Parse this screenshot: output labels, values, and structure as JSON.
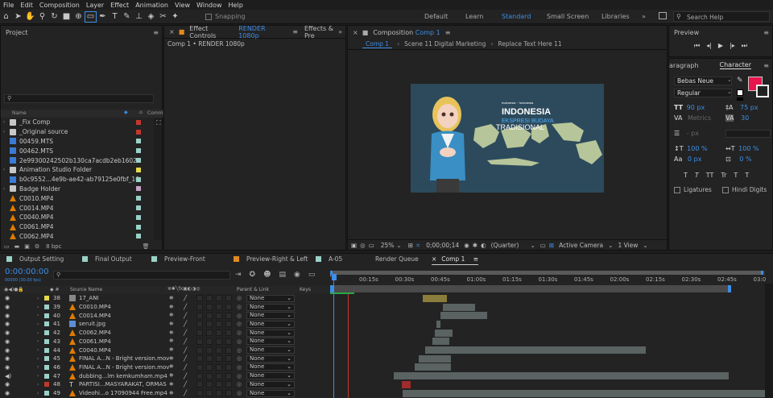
{
  "menu": [
    "File",
    "Edit",
    "Composition",
    "Layer",
    "Effect",
    "Animation",
    "View",
    "Window",
    "Help"
  ],
  "toolbar": {
    "snapping_label": "Snapping",
    "workspaces": [
      "Default",
      "Learn",
      "Standard",
      "Small Screen",
      "Libraries"
    ],
    "active_workspace": "Standard",
    "search_placeholder": "Search Help"
  },
  "project_panel": {
    "title": "Project",
    "col_name": "Name",
    "col_comment": "Comm",
    "bpc": "8 bpc",
    "items": [
      {
        "name": "_Fix Comp",
        "type": "folder",
        "label_color": "#c0392b"
      },
      {
        "name": "_Original source",
        "type": "folder",
        "label_color": "#c0392b"
      },
      {
        "name": "00459.MTS",
        "type": "file",
        "label_color": "#9ad1c8"
      },
      {
        "name": "00462.MTS",
        "type": "file",
        "label_color": "#9ad1c8"
      },
      {
        "name": "2e99300242502b130ca7acdb2eb16022.jpg",
        "type": "file",
        "label_color": "#9ad1c8"
      },
      {
        "name": "Animation Studio Folder",
        "type": "folder",
        "label_color": "#e6d84a"
      },
      {
        "name": "b0c9552...4e9b-ae42-ab79125e0fbf_169.jpeg",
        "type": "file",
        "label_color": "#9ad1c8"
      },
      {
        "name": "Badge Holder",
        "type": "folder",
        "label_color": "#c8a2c8"
      },
      {
        "name": "C0010.MP4",
        "type": "video",
        "label_color": "#9ad1c8"
      },
      {
        "name": "C0014.MP4",
        "type": "video",
        "label_color": "#9ad1c8"
      },
      {
        "name": "C0040.MP4",
        "type": "video",
        "label_color": "#9ad1c8"
      },
      {
        "name": "C0061.MP4",
        "type": "video",
        "label_color": "#9ad1c8"
      },
      {
        "name": "C0062.MP4",
        "type": "video",
        "label_color": "#9ad1c8"
      }
    ]
  },
  "effect_controls": {
    "tab_prefix": "Effect Controls",
    "tab_target": "RENDER 1080p",
    "tab2": "Effects & Pre",
    "breadcrumb": "Comp 1 • RENDER 1080p"
  },
  "composition_panel": {
    "tab_prefix": "Composition",
    "tab_target": "Comp 1",
    "nav": [
      "Comp 1",
      "Scene 11 Digital Marketing",
      "Replace Text Here 11"
    ],
    "zoom": "25%",
    "timecode": "0;00;00;14",
    "resolution": "(Quarter)",
    "camera": "Active Camera",
    "views": "1 View",
    "preview_text_small": "Indonesia ~ Indonesia",
    "preview_title": "INDONESIA",
    "preview_sub1": "EKSPRESI BUDAYA",
    "preview_sub2": "TRADISIONAL"
  },
  "preview_panel": {
    "title": "Preview"
  },
  "character_panel": {
    "tab1": "aragraph",
    "tab2": "Character",
    "font": "Bebas Neue",
    "style": "Regular",
    "font_size": "90 px",
    "leading": "75 px",
    "kerning": "Metrics",
    "tracking": "30",
    "indent": "- px",
    "vscale": "100 %",
    "hscale": "100 %",
    "baseline": "0 px",
    "tsume": "0 %",
    "ligatures": "Ligatures",
    "hindi_digits": "Hindi Digits",
    "fill_color": "#e8144c",
    "format_buttons": [
      "T",
      "T",
      "TT",
      "Tr",
      "T",
      "T"
    ]
  },
  "timeline": {
    "tabs": [
      {
        "name": "Output Setting",
        "color": "#9ad1c8"
      },
      {
        "name": "Final Output",
        "color": "#9ad1c8"
      },
      {
        "name": "Preview-Front",
        "color": "#9ad1c8"
      },
      {
        "name": "Preview-Right & Left",
        "color": "#e08a1e"
      },
      {
        "name": "A-05",
        "color": "#9ad1c8"
      },
      {
        "name": "Render Queue",
        "color": ""
      },
      {
        "name": "Comp 1",
        "color": "",
        "active": true
      }
    ],
    "timecode": "0:00:00:00",
    "fps": "00000 (30.00 fps)",
    "col_source": "Source Name",
    "col_parent": "Parent & Link",
    "col_keys": "Keys",
    "ruler": [
      "00:15s",
      "00:30s",
      "00:45s",
      "01:00s",
      "01:15s",
      "01:30s",
      "01:45s",
      "02:00s",
      "02:15s",
      "02:30s",
      "02:45s",
      "03:0"
    ],
    "layers": [
      {
        "num": "38",
        "name": "17_ANI",
        "color": "#e6d84a",
        "type": "comp",
        "parent": "None",
        "bar": [
          525,
          555
        ],
        "bar_color": "#8a7c3a"
      },
      {
        "num": "39",
        "name": "C0010.MP4",
        "color": "#9ad1c8",
        "type": "video",
        "parent": "None",
        "bar": [
          550,
          590
        ],
        "bar_color": "#5a6262"
      },
      {
        "num": "40",
        "name": "C0014.MP4",
        "color": "#9ad1c8",
        "type": "video",
        "parent": "None",
        "bar": [
          547,
          605
        ],
        "bar_color": "#5a6262"
      },
      {
        "num": "41",
        "name": "seruit.jpg",
        "color": "#9ad1c8",
        "type": "image",
        "parent": "None",
        "bar": [
          542,
          547
        ],
        "bar_color": "#5a6262"
      },
      {
        "num": "42",
        "name": "C0062.MP4",
        "color": "#9ad1c8",
        "type": "video",
        "parent": "None",
        "bar": [
          540,
          562
        ],
        "bar_color": "#5a6262"
      },
      {
        "num": "43",
        "name": "C0061.MP4",
        "color": "#9ad1c8",
        "type": "video",
        "parent": "None",
        "bar": [
          537,
          558
        ],
        "bar_color": "#5a6262"
      },
      {
        "num": "44",
        "name": "C0040.MP4",
        "color": "#9ad1c8",
        "type": "video",
        "parent": "None",
        "bar": [
          528,
          802
        ],
        "bar_color": "#5a6262"
      },
      {
        "num": "45",
        "name": "FINAL A...N - Bright version.mov",
        "color": "#9ad1c8",
        "type": "video",
        "parent": "None",
        "bar": [
          520,
          560
        ],
        "bar_color": "#5a6262"
      },
      {
        "num": "46",
        "name": "FINAL A...N - Bright version.mov",
        "color": "#9ad1c8",
        "type": "video",
        "parent": "None",
        "bar": [
          515,
          560
        ],
        "bar_color": "#5a6262"
      },
      {
        "num": "47",
        "name": "dubbing...lm kemkumham.mp4",
        "color": "#9ad1c8",
        "type": "audio",
        "parent": "None",
        "bar": [
          489,
          905
        ],
        "bar_color": "#5a6262"
      },
      {
        "num": "48",
        "name": "PARTISI...MASYARAKAT, ORMAS",
        "color": "#c0392b",
        "type": "text",
        "parent": "None",
        "bar": [
          499,
          510
        ],
        "bar_color": "#a02c2c"
      },
      {
        "num": "49",
        "name": "Videohi...o 17090944 Free.mp4",
        "color": "#9ad1c8",
        "type": "video",
        "parent": "None",
        "bar": [
          500,
          950
        ],
        "bar_color": "#5a6262"
      }
    ]
  }
}
